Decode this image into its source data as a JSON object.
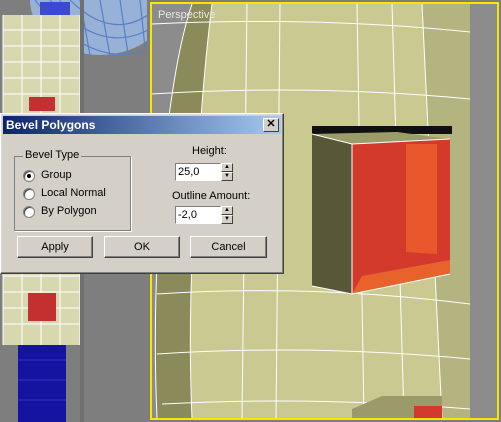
{
  "viewports": {
    "perspective_label": "Perspective"
  },
  "dialog": {
    "title": "Bevel Polygons",
    "close_icon": "close-icon",
    "bevel_type": {
      "label": "Bevel Type",
      "options": [
        "Group",
        "Local Normal",
        "By Polygon"
      ],
      "selected": "Group"
    },
    "height": {
      "label": "Height:",
      "value": "25,0"
    },
    "outline_amount": {
      "label": "Outline Amount:",
      "value": "-2,0"
    },
    "buttons": {
      "apply": "Apply",
      "ok": "OK",
      "cancel": "Cancel"
    }
  },
  "colors": {
    "active_viewport_border": "#f7e600",
    "titlebar_start": "#0a246a",
    "titlebar_end": "#a6caf0",
    "mesh_face": "#c8c890",
    "selected_face": "#d43a2c"
  }
}
